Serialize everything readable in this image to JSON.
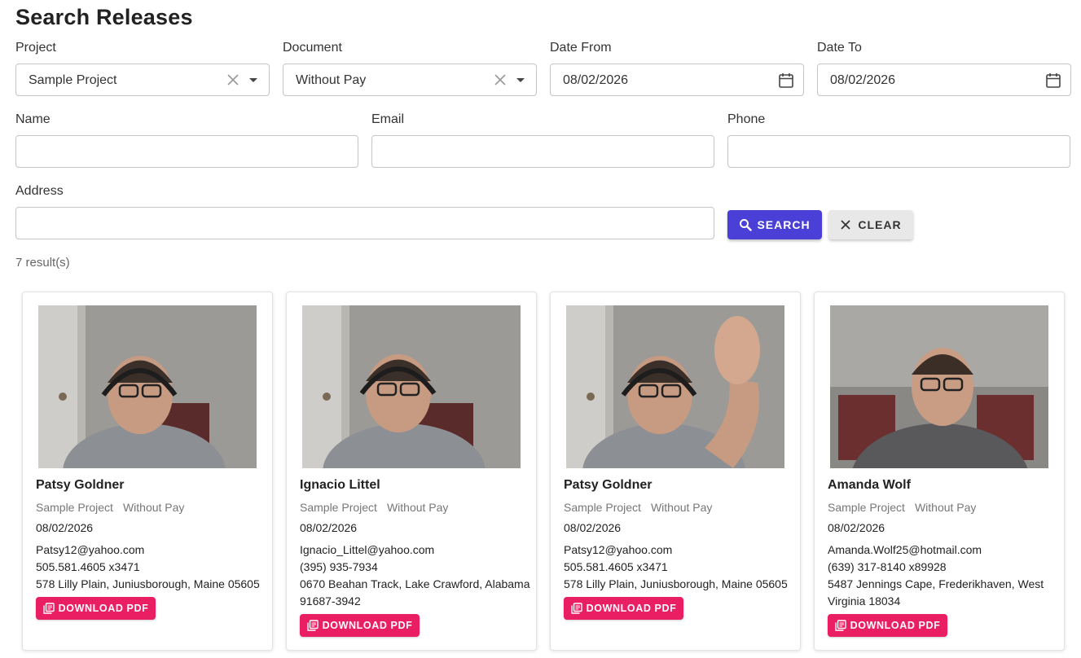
{
  "page_title": "Search Releases",
  "filters": {
    "project": {
      "label": "Project",
      "value": "Sample Project"
    },
    "document": {
      "label": "Document",
      "value": "Without Pay"
    },
    "date_from": {
      "label": "Date From",
      "value": "08/02/2026"
    },
    "date_to": {
      "label": "Date To",
      "value": "08/02/2026"
    },
    "name": {
      "label": "Name",
      "value": ""
    },
    "email": {
      "label": "Email",
      "value": ""
    },
    "phone": {
      "label": "Phone",
      "value": ""
    },
    "address": {
      "label": "Address",
      "value": ""
    }
  },
  "buttons": {
    "search": "SEARCH",
    "clear": "CLEAR"
  },
  "results_count": "7 result(s)",
  "cards": [
    {
      "name": "Patsy Goldner",
      "project": "Sample Project",
      "document": "Without Pay",
      "date": "08/02/2026",
      "email": "Patsy12@yahoo.com",
      "phone": "505.581.4605 x3471",
      "address": "578 Lilly Plain, Juniusborough, Maine 05605",
      "download": "DOWNLOAD PDF"
    },
    {
      "name": "Ignacio Littel",
      "project": "Sample Project",
      "document": "Without Pay",
      "date": "08/02/2026",
      "email": "Ignacio_Littel@yahoo.com",
      "phone": "(395) 935-7934",
      "address": "0670 Beahan Track, Lake Crawford, Alabama 91687-3942",
      "download": "DOWNLOAD PDF"
    },
    {
      "name": "Patsy Goldner",
      "project": "Sample Project",
      "document": "Without Pay",
      "date": "08/02/2026",
      "email": "Patsy12@yahoo.com",
      "phone": "505.581.4605 x3471",
      "address": "578 Lilly Plain, Juniusborough, Maine 05605",
      "download": "DOWNLOAD PDF"
    },
    {
      "name": "Amanda Wolf",
      "project": "Sample Project",
      "document": "Without Pay",
      "date": "08/02/2026",
      "email": "Amanda.Wolf25@hotmail.com",
      "phone": "(639) 317-8140 x89928",
      "address": "5487 Jennings Cape, Frederikhaven, West Virginia 18034",
      "download": "DOWNLOAD PDF"
    }
  ],
  "colors": {
    "search_button": "#4a3fd6",
    "download_button": "#e91e63",
    "clear_button": "#e8e8e8"
  },
  "icons": {
    "search": "search-icon",
    "clear": "close-icon",
    "download": "pdf-icon",
    "calendar": "calendar-icon",
    "dropdown": "chevron-down-icon"
  }
}
